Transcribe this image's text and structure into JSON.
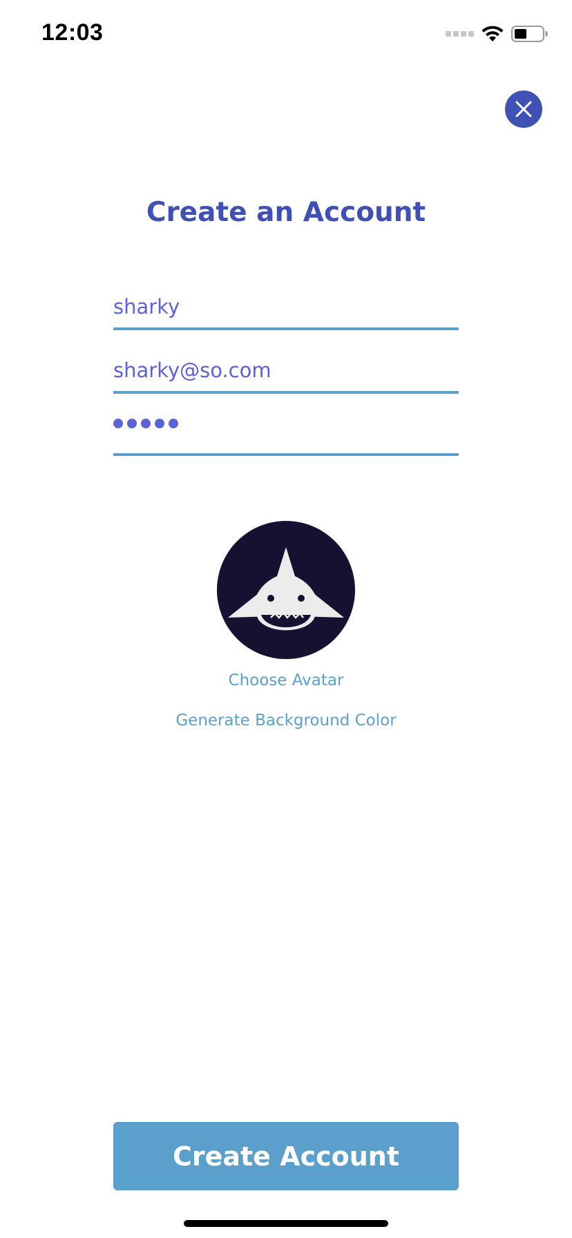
{
  "status_bar": {
    "time": "12:03",
    "icons": [
      "cellular-signal-icon",
      "wifi-icon",
      "battery-icon"
    ]
  },
  "header": {
    "close_icon": "close-icon",
    "title": "Create an Account"
  },
  "form": {
    "username": {
      "value": "sharky"
    },
    "email": {
      "value": "sharky@so.com"
    },
    "password": {
      "masked_length": 5
    }
  },
  "avatar": {
    "icon": "shark-avatar",
    "background_color": "#151231",
    "choose_label": "Choose Avatar",
    "generate_bg_label": "Generate Background Color"
  },
  "primary_action": {
    "label": "Create Account"
  },
  "colors": {
    "accent": "#3f51b5",
    "link": "#5ba0cc",
    "input_text": "#5b64d6",
    "button": "#5ba0cc"
  }
}
